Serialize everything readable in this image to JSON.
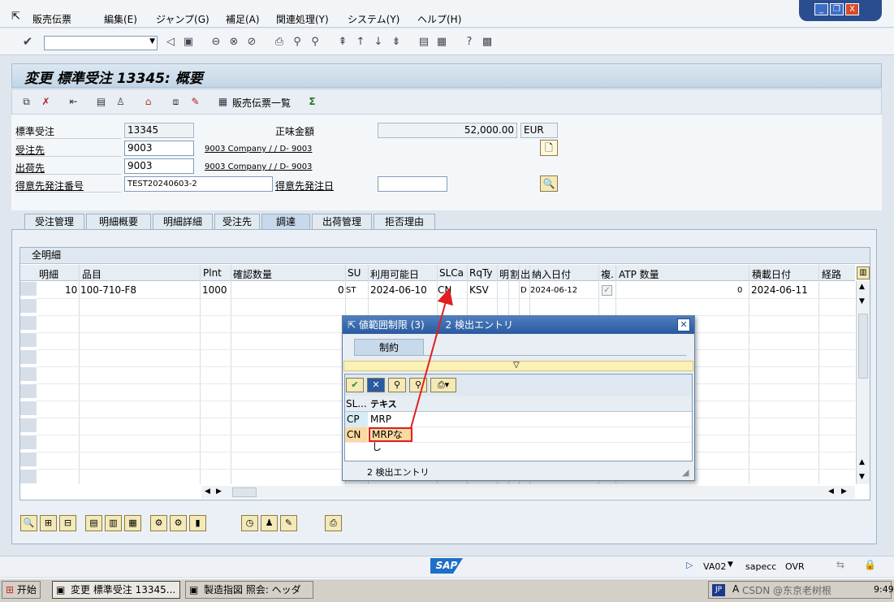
{
  "menubar": {
    "items": [
      "販売伝票",
      "編集(E)",
      "ジャンプ(G)",
      "補足(A)",
      "関連処理(Y)",
      "システム(Y)",
      "ヘルプ(H)"
    ]
  },
  "window_controls": {
    "minimize": "_",
    "restore": "❐",
    "close": "X"
  },
  "toolbar": {
    "command_field": ""
  },
  "title": "変更 標準受注 13345: 概要",
  "app_toolbar": {
    "doc_list_label": "販売伝票一覧"
  },
  "header": {
    "order_type_label": "標準受注",
    "order_number": "13345",
    "net_value_label": "正味金額",
    "net_value": "52,000.00",
    "currency": "EUR",
    "sold_to_label": "受注先",
    "sold_to_value": "9003",
    "sold_to_desc": "9003 Company / / D- 9003",
    "ship_to_label": "出荷先",
    "ship_to_value": "9003",
    "ship_to_desc": "9003 Company / / D- 9003",
    "po_number_label": "得意先発注番号",
    "po_number_value": "TEST20240603-2",
    "po_date_label": "得意先発注日",
    "po_date_value": ""
  },
  "tabs": [
    "受注管理",
    "明細概要",
    "明細詳細",
    "受注先",
    "調達",
    "出荷管理",
    "拒否理由"
  ],
  "active_tab": "調達",
  "grid": {
    "title": "全明細",
    "columns": [
      "明細",
      "品目",
      "Plnt",
      "確認数量",
      "SU",
      "利用可能日",
      "SLCa",
      "RqTy",
      "明",
      "割",
      "出",
      "納入日付",
      "複.",
      "ATP 数量",
      "積載日付",
      "経路"
    ],
    "rows": [
      {
        "item": "10",
        "material": "100-710-F8",
        "plant": "1000",
        "confirmed_qty": "0",
        "su": "ST",
        "avail_date": "2024-06-10",
        "slca": "CN",
        "rqty": "KSV",
        "flag": "D",
        "delivery_date": "2024-06-12",
        "atp_qty": "0",
        "loading_date": "2024-06-11"
      }
    ]
  },
  "popup": {
    "title": "値範囲制限 (3)",
    "title_hits": "2 検出エントリ",
    "tab_label": "制約",
    "col_key": "SL...",
    "col_text": "テキス",
    "entries": [
      {
        "key": "CP",
        "text": "MRP"
      },
      {
        "key": "CN",
        "text": "MRPなし"
      }
    ],
    "status": "2 検出エントリ"
  },
  "statusbar": {
    "logo": "SAP",
    "transaction": "VA02",
    "system": "sapecc",
    "mode": "OVR"
  },
  "taskbar": {
    "start_label": "开始",
    "buttons": [
      "変更 標準受注 13345...",
      "製造指図 照会: ヘッダ"
    ],
    "tray_lang": "JP",
    "tray_watermark": "CSDN @东京老树根",
    "clock": "9:49"
  },
  "colors": {
    "accent": "#2a5aa0",
    "arrow": "#e02020",
    "highlight_row": "#fcd9a0",
    "highlight_border": "#e02020",
    "sap_blue": "#1e6fc7"
  }
}
